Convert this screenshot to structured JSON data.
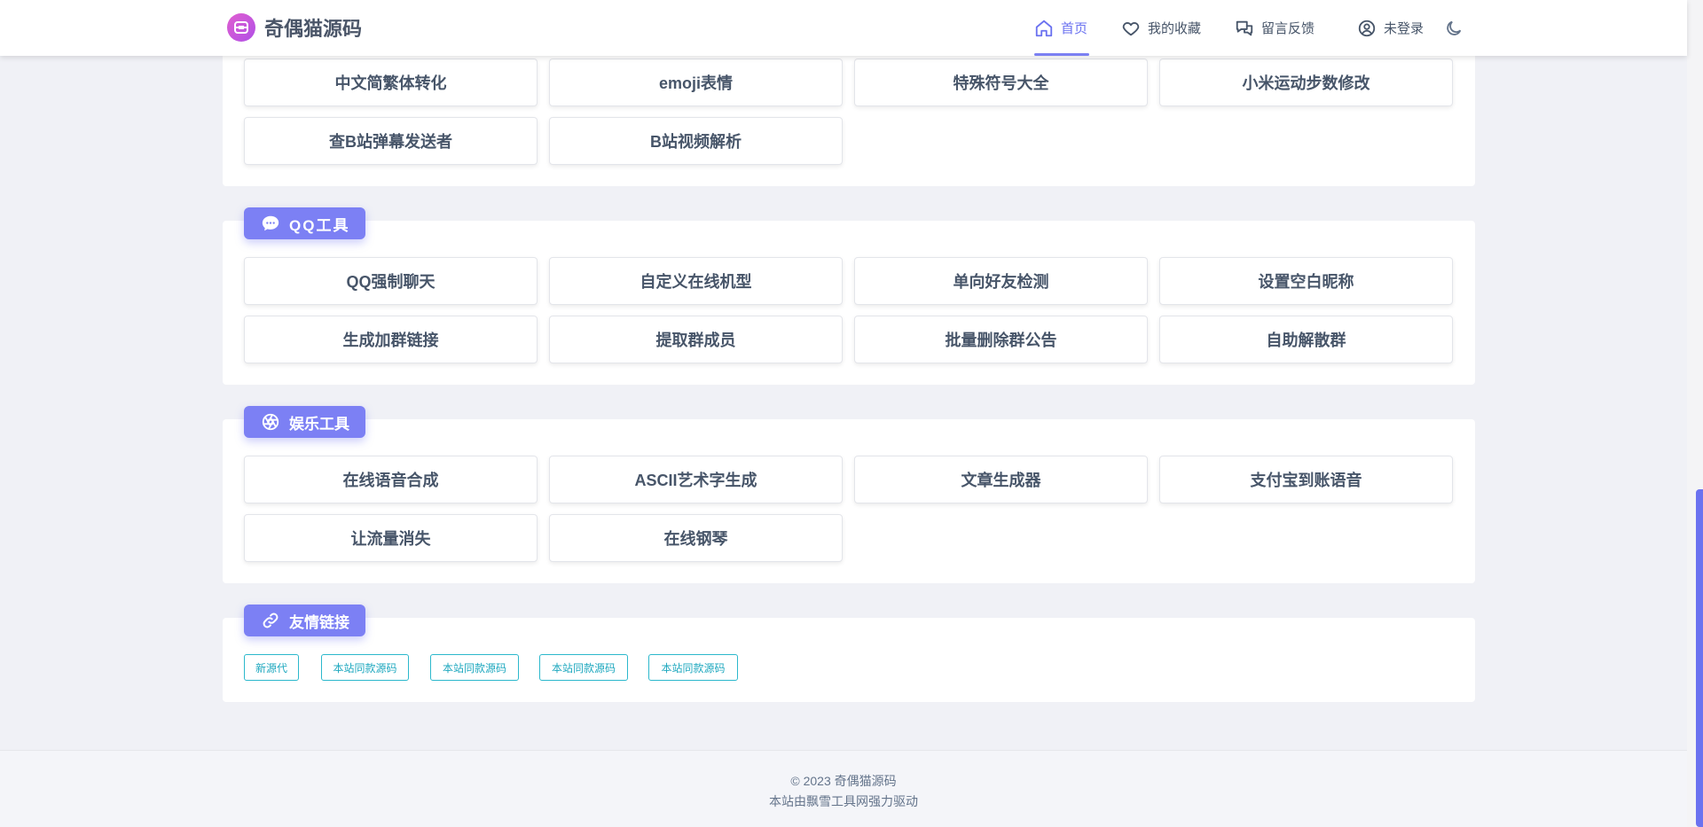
{
  "header": {
    "site_name": "奇偶猫源码",
    "nav": {
      "home": "首页",
      "favorites": "我的收藏",
      "feedback": "留言反馈",
      "login": "未登录"
    }
  },
  "sections": {
    "top": {
      "tools": [
        "中文简繁体转化",
        "emoji表情",
        "特殊符号大全",
        "小米运动步数修改",
        "查B站弹幕发送者",
        "B站视频解析"
      ]
    },
    "qq": {
      "title": "QQ工具",
      "tools": [
        "QQ强制聊天",
        "自定义在线机型",
        "单向好友检测",
        "设置空白昵称",
        "生成加群链接",
        "提取群成员",
        "批量删除群公告",
        "自助解散群"
      ]
    },
    "fun": {
      "title": "娱乐工具",
      "tools": [
        "在线语音合成",
        "ASCII艺术字生成",
        "文章生成器",
        "支付宝到账语音",
        "让流量消失",
        "在线钢琴"
      ]
    },
    "links": {
      "title": "友情链接",
      "items": [
        "新源代",
        "本站同款源码",
        "本站同款源码",
        "本站同款源码",
        "本站同款源码"
      ]
    }
  },
  "footer": {
    "copyright": "© 2023 奇偶猫源码",
    "powered": "本站由飘雪工具网强力驱动"
  },
  "colors": {
    "accent": "#7c80f4",
    "link": "#1ea8bf"
  }
}
